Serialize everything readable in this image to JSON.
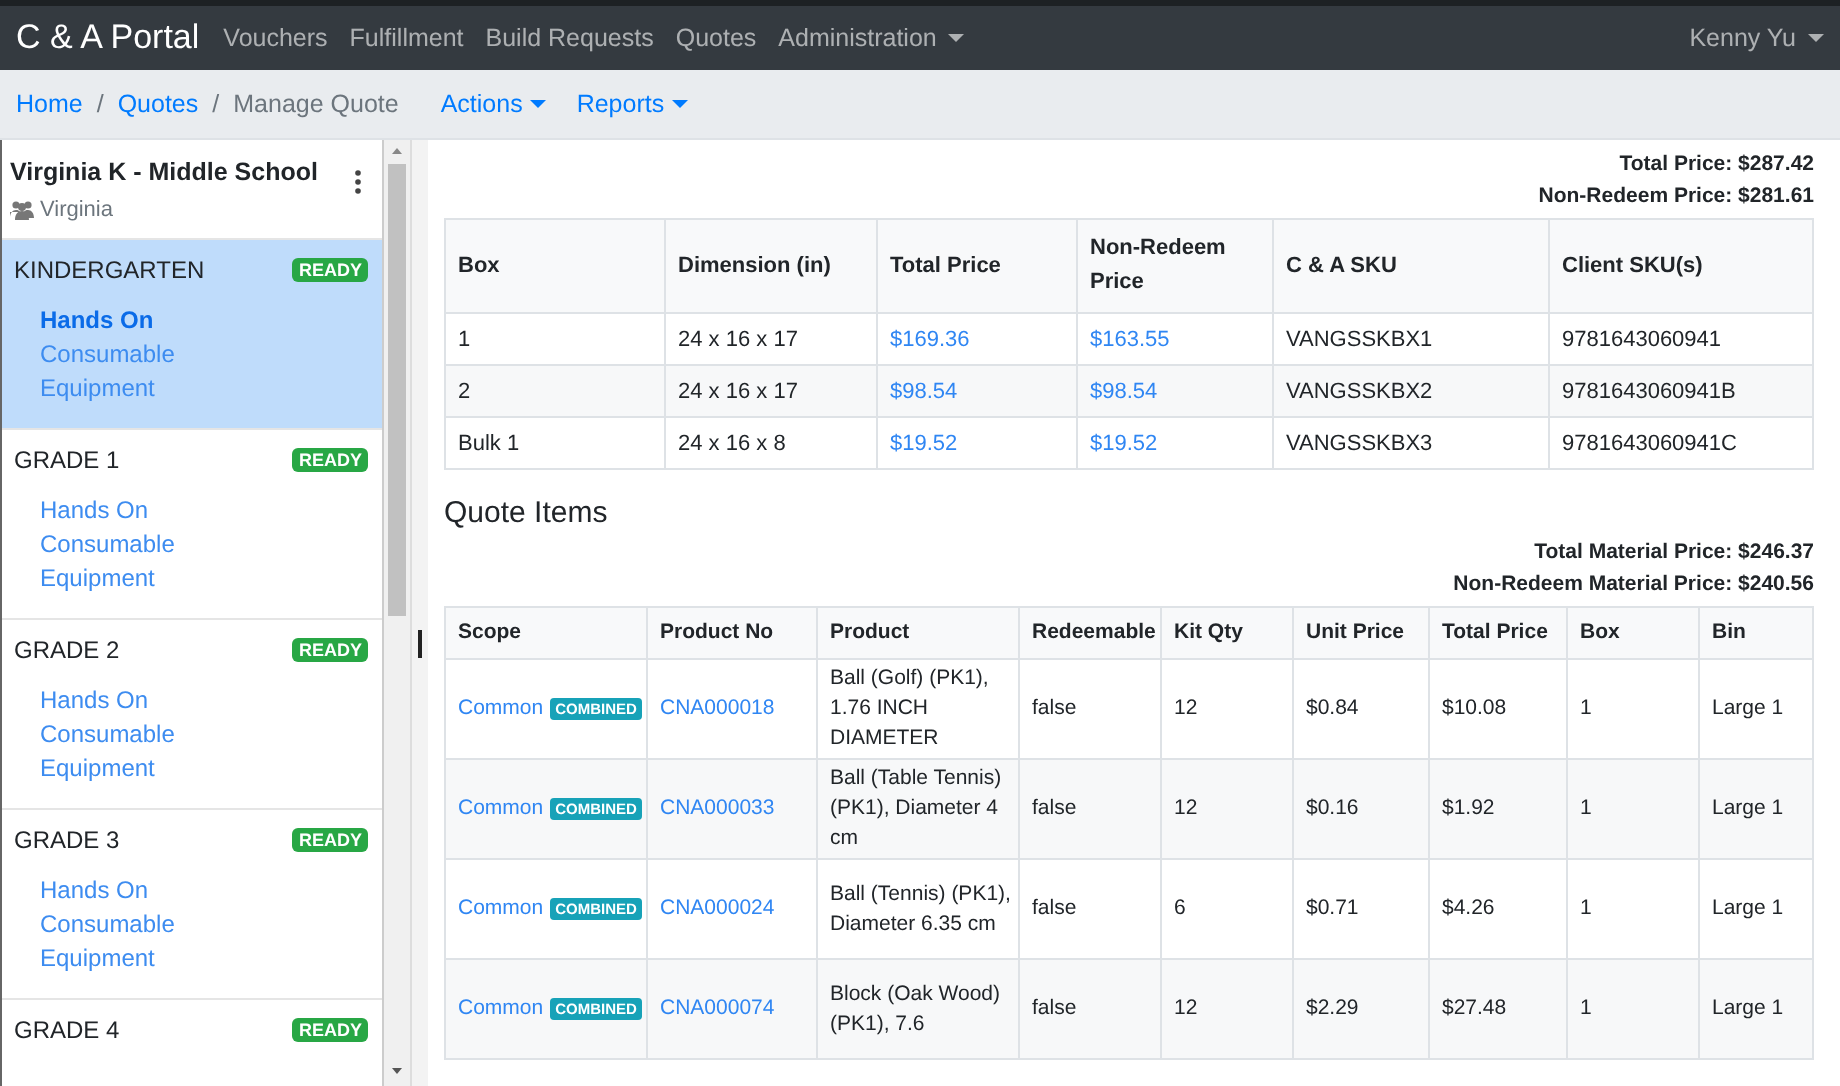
{
  "navbar": {
    "brand": "C & A Portal",
    "links": [
      {
        "label": "Vouchers",
        "dropdown": false
      },
      {
        "label": "Fulfillment",
        "dropdown": false
      },
      {
        "label": "Build Requests",
        "dropdown": false
      },
      {
        "label": "Quotes",
        "dropdown": false
      },
      {
        "label": "Administration",
        "dropdown": true
      }
    ],
    "user": {
      "label": "Kenny Yu",
      "dropdown": true
    }
  },
  "breadcrumb": {
    "items": [
      {
        "label": "Home",
        "current": false
      },
      {
        "separator": "/",
        "label": "Quotes",
        "current": false
      },
      {
        "separator": "/",
        "label": "Manage Quote",
        "current": true
      }
    ],
    "menus": [
      {
        "label": "Actions"
      },
      {
        "label": "Reports"
      }
    ]
  },
  "sidebar": {
    "title": "Virginia K - Middle School",
    "subtitle": "Virginia",
    "groups": [
      {
        "name": "KINDERGARTEN",
        "status": "READY",
        "selected": true,
        "links": [
          {
            "label": "Hands On",
            "selected": true
          },
          {
            "label": "Consumable",
            "selected": false
          },
          {
            "label": "Equipment",
            "selected": false
          }
        ]
      },
      {
        "name": "GRADE 1",
        "status": "READY",
        "selected": false,
        "links": [
          {
            "label": "Hands On",
            "selected": false
          },
          {
            "label": "Consumable",
            "selected": false
          },
          {
            "label": "Equipment",
            "selected": false
          }
        ]
      },
      {
        "name": "GRADE 2",
        "status": "READY",
        "selected": false,
        "links": [
          {
            "label": "Hands On",
            "selected": false
          },
          {
            "label": "Consumable",
            "selected": false
          },
          {
            "label": "Equipment",
            "selected": false
          }
        ]
      },
      {
        "name": "GRADE 3",
        "status": "READY",
        "selected": false,
        "links": [
          {
            "label": "Hands On",
            "selected": false
          },
          {
            "label": "Consumable",
            "selected": false
          },
          {
            "label": "Equipment",
            "selected": false
          }
        ]
      },
      {
        "name": "GRADE 4",
        "status": "READY",
        "selected": false
      }
    ]
  },
  "main": {
    "totals": [
      "Total Price: $287.42",
      "Non-Redeem Price: $281.61"
    ],
    "boxes": {
      "columns": [
        {
          "label": "Box",
          "kind": "text"
        },
        {
          "label": "Dimension (in)",
          "kind": "text"
        },
        {
          "label": "Total Price",
          "kind": "link"
        },
        {
          "label": "Non-Redeem Price",
          "kind": "link"
        },
        {
          "label": "C & A SKU",
          "kind": "text"
        },
        {
          "label": "Client SKU(s)",
          "kind": "text"
        }
      ],
      "rows": [
        [
          "1",
          "24 x 16 x 17",
          "$169.36",
          "$163.55",
          "VANGSSKBX1",
          "9781643060941"
        ],
        [
          "2",
          "24 x 16 x 17",
          "$98.54",
          "$98.54",
          "VANGSSKBX2",
          "9781643060941B"
        ],
        [
          "Bulk 1",
          "24 x 16 x 8",
          "$19.52",
          "$19.52",
          "VANGSSKBX3",
          "9781643060941C"
        ]
      ]
    },
    "section_title": "Quote Items",
    "item_totals": [
      "Total Material Price: $246.37",
      "Non-Redeem Material Price: $240.56"
    ],
    "items": {
      "columns": [
        {
          "label": "Scope",
          "kind": "scope"
        },
        {
          "label": "Product No",
          "kind": "link"
        },
        {
          "label": "Product",
          "kind": "text"
        },
        {
          "label": "Redeemable",
          "kind": "text"
        },
        {
          "label": "Kit Qty",
          "kind": "text"
        },
        {
          "label": "Unit Price",
          "kind": "text"
        },
        {
          "label": "Total Price",
          "kind": "text"
        },
        {
          "label": "Box",
          "kind": "text"
        },
        {
          "label": "Bin",
          "kind": "text"
        }
      ],
      "rows": [
        [
          {
            "label": "Common",
            "badge": "COMBINED"
          },
          "CNA000018",
          "Ball (Golf) (PK1), 1.76 INCH DIAMETER",
          "false",
          "12",
          "$0.84",
          "$10.08",
          "1",
          "Large 1"
        ],
        [
          {
            "label": "Common",
            "badge": "COMBINED"
          },
          "CNA000033",
          "Ball (Table Tennis) (PK1), Diameter 4 cm",
          "false",
          "12",
          "$0.16",
          "$1.92",
          "1",
          "Large 1"
        ],
        [
          {
            "label": "Common",
            "badge": "COMBINED"
          },
          "CNA000024",
          "Ball (Tennis) (PK1), Diameter 6.35 cm",
          "false",
          "6",
          "$0.71",
          "$4.26",
          "1",
          "Large 1"
        ],
        [
          {
            "label": "Common",
            "badge": "COMBINED"
          },
          "CNA000074",
          "Block (Oak Wood) (PK1), 7.6",
          "false",
          "12",
          "$2.29",
          "$27.48",
          "1",
          "Large 1"
        ]
      ]
    }
  }
}
